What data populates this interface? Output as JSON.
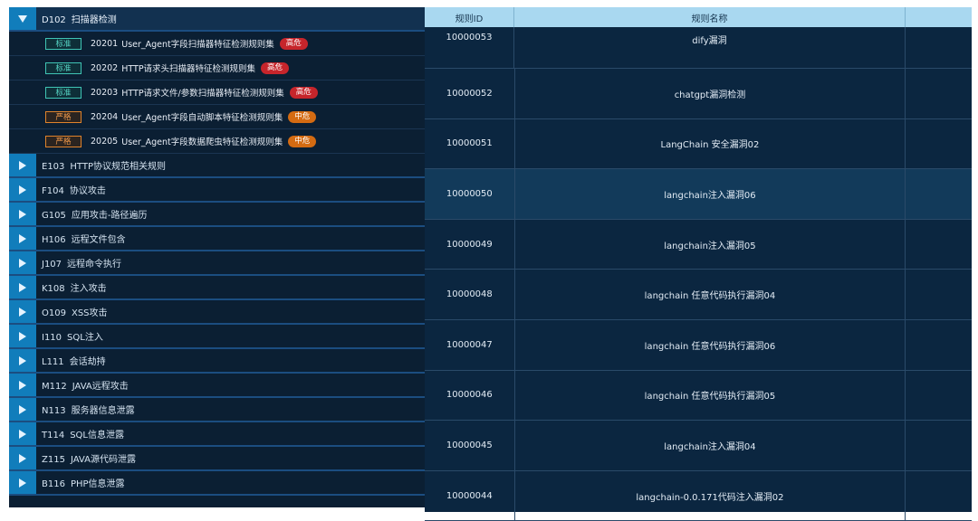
{
  "tree": {
    "expanded": {
      "code": "D102",
      "name": "扫描器检测",
      "rules": [
        {
          "mode": "标准",
          "mode_type": "std",
          "id": "20201",
          "name": "User_Agent字段扫描器特征检测规则集",
          "risk": "高危",
          "risk_type": "high"
        },
        {
          "mode": "标准",
          "mode_type": "std",
          "id": "20202",
          "name": "HTTP请求头扫描器特征检测规则集",
          "risk": "高危",
          "risk_type": "high"
        },
        {
          "mode": "标准",
          "mode_type": "std",
          "id": "20203",
          "name": "HTTP请求文件/参数扫描器特征检测规则集",
          "risk": "高危",
          "risk_type": "high"
        },
        {
          "mode": "严格",
          "mode_type": "strict",
          "id": "20204",
          "name": "User_Agent字段自动脚本特征检测规则集",
          "risk": "中危",
          "risk_type": "mid"
        },
        {
          "mode": "严格",
          "mode_type": "strict",
          "id": "20205",
          "name": "User_Agent字段数据爬虫特征检测规则集",
          "risk": "中危",
          "risk_type": "mid"
        }
      ]
    },
    "categories": [
      {
        "code": "E103",
        "name": "HTTP协议规范相关规则"
      },
      {
        "code": "F104",
        "name": "协议攻击"
      },
      {
        "code": "G105",
        "name": "应用攻击-路径遍历"
      },
      {
        "code": "H106",
        "name": "远程文件包含"
      },
      {
        "code": "J107",
        "name": "远程命令执行"
      },
      {
        "code": "K108",
        "name": "注入攻击"
      },
      {
        "code": "O109",
        "name": "XSS攻击"
      },
      {
        "code": "I110",
        "name": "SQL注入"
      },
      {
        "code": "L111",
        "name": "会话劫持"
      },
      {
        "code": "M112",
        "name": "JAVA远程攻击"
      },
      {
        "code": "N113",
        "name": "服务器信息泄露"
      },
      {
        "code": "T114",
        "name": "SQL信息泄露"
      },
      {
        "code": "Z115",
        "name": "JAVA源代码泄露"
      },
      {
        "code": "B116",
        "name": "PHP信息泄露"
      }
    ]
  },
  "table": {
    "headers": {
      "id": "规则ID",
      "name": "规则名称"
    },
    "rows": [
      {
        "id": "10000053",
        "name": "dify漏洞"
      },
      {
        "id": "10000052",
        "name": "chatgpt漏洞检测"
      },
      {
        "id": "10000051",
        "name": "LangChain 安全漏洞02"
      },
      {
        "id": "10000050",
        "name": "langchain注入漏洞06"
      },
      {
        "id": "10000049",
        "name": "langchain注入漏洞05"
      },
      {
        "id": "10000048",
        "name": "langchain 任意代码执行漏洞04"
      },
      {
        "id": "10000047",
        "name": "langchain 任意代码执行漏洞06"
      },
      {
        "id": "10000046",
        "name": "langchain 任意代码执行漏洞05"
      },
      {
        "id": "10000045",
        "name": "langchain注入漏洞04"
      },
      {
        "id": "10000044",
        "name": "langchain-0.0.171代码注入漏洞02"
      }
    ]
  },
  "colors": {
    "panel_bg": "#0b1f33",
    "expander_bg": "#117dbb",
    "header_bg": "#a9d8f0",
    "risk_high": "#c6252b",
    "risk_mid": "#d46b12"
  },
  "icons": {
    "expanded": "caret-down-icon",
    "collapsed": "caret-right-icon"
  }
}
